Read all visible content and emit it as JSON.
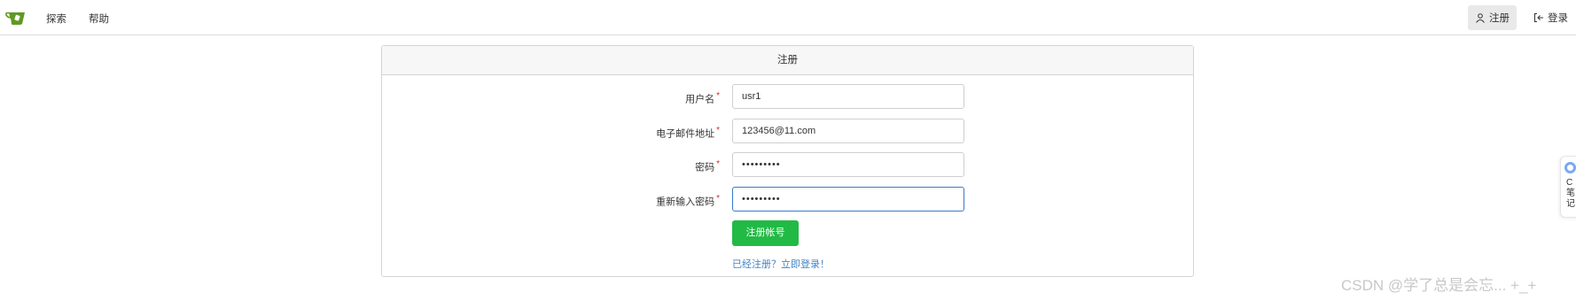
{
  "nav": {
    "logo_icon": "gitea-teacup-icon",
    "logo_color": "#609926",
    "explore_label": "探索",
    "help_label": "帮助",
    "register_label": "注册",
    "login_label": "登录",
    "register_icon": "person-icon",
    "login_icon": "sign-in-icon"
  },
  "form": {
    "title": "注册",
    "fields": [
      {
        "label": "用户名",
        "value": "usr1",
        "required": true
      },
      {
        "label": "电子邮件地址",
        "value": "123456@11.com",
        "required": true
      },
      {
        "label": "密码",
        "value": "•••••••••",
        "required": true,
        "type": "password"
      },
      {
        "label": "重新输入密码",
        "value": "•••••••••",
        "required": true,
        "type": "password",
        "focused": true
      }
    ],
    "required_mark": "*",
    "submit_label": "注册帐号",
    "submit_color": "#21ba45",
    "login_link": "已经注册？立即登录！",
    "link_color": "#4183c4"
  },
  "side_widget": {
    "text": "C笔记",
    "icon": "note-circle-icon"
  },
  "watermark": "CSDN @学了总是会忘... +_+"
}
